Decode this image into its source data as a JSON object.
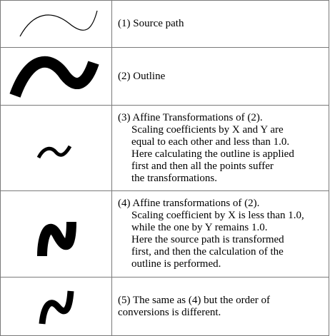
{
  "rows": [
    {
      "figure": "source-path",
      "caption": "(1) Source path",
      "detail": ""
    },
    {
      "figure": "outline",
      "caption": "(2) Outline",
      "detail": ""
    },
    {
      "figure": "affine-uniform-scaled-outline",
      "caption": "(3) Affine Transformations of (2).",
      "detail": "Scaling coefficients by X and Y are\nequal to each other and less than 1.0.\nHere calculating the outline is applied\nfirst and then all the points suffer\nthe transformations."
    },
    {
      "figure": "affine-x-scaled-path-then-outline",
      "caption": "(4) Affine transformations of (2).",
      "detail": "Scaling coefficient by X is less than 1.0,\nwhile the one by Y remains 1.0.\nHere the source path is transformed\nfirst, and then the calculation of the\noutline is performed."
    },
    {
      "figure": "affine-x-scaled-outline-then-transform",
      "caption": "(5) The same as (4) but the order of\nconversions is different.",
      "detail": ""
    }
  ],
  "colors": {
    "stroke": "#000000",
    "grid": "#7a7a7a",
    "background": "#ffffff"
  }
}
